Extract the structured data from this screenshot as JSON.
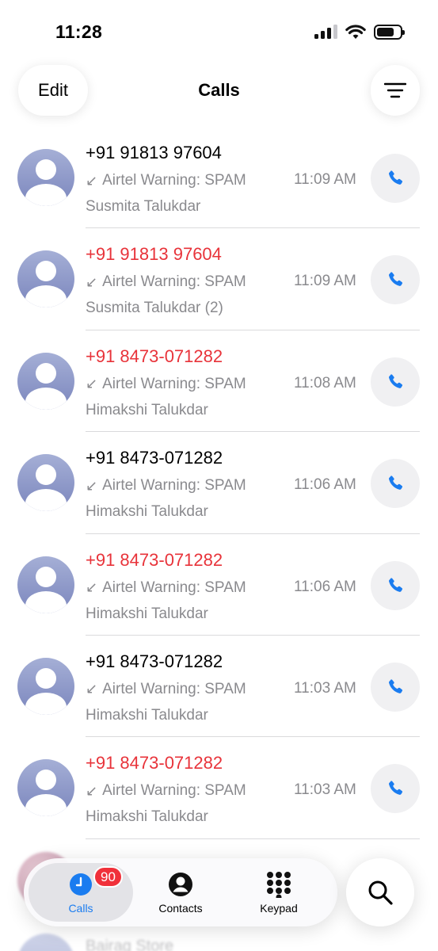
{
  "status_bar": {
    "time": "11:28"
  },
  "header": {
    "edit_label": "Edit",
    "title": "Calls"
  },
  "calls": [
    {
      "caller": "+91 91813 97604",
      "missed": false,
      "label": "Airtel Warning: SPAM",
      "name": "Susmita Talukdar",
      "time": "11:09 AM"
    },
    {
      "caller": "+91 91813 97604",
      "missed": true,
      "label": "Airtel Warning: SPAM",
      "name": "Susmita Talukdar (2)",
      "time": "11:09 AM"
    },
    {
      "caller": "+91 8473-071282",
      "missed": true,
      "label": "Airtel Warning: SPAM",
      "name": "Himakshi Talukdar",
      "time": "11:08 AM"
    },
    {
      "caller": "+91 8473-071282",
      "missed": false,
      "label": "Airtel Warning: SPAM",
      "name": "Himakshi Talukdar",
      "time": "11:06 AM"
    },
    {
      "caller": "+91 8473-071282",
      "missed": true,
      "label": "Airtel Warning: SPAM",
      "name": "Himakshi Talukdar",
      "time": "11:06 AM"
    },
    {
      "caller": "+91 8473-071282",
      "missed": false,
      "label": "Airtel Warning: SPAM",
      "name": "Himakshi Talukdar",
      "time": "11:03 AM"
    },
    {
      "caller": "+91 8473-071282",
      "missed": true,
      "label": "Airtel Warning: SPAM",
      "name": "Himakshi Talukdar",
      "time": "11:03 AM"
    }
  ],
  "partial_row": {
    "name": "Bairag Store"
  },
  "tab_bar": {
    "calls_label": "Calls",
    "calls_badge": "90",
    "contacts_label": "Contacts",
    "keypad_label": "Keypad"
  },
  "colors": {
    "accent": "#1a7cf0",
    "missed": "#e8333a",
    "secondary_text": "#8a8a8e",
    "badge": "#f0303a"
  },
  "icons": {
    "arrow": "incoming-arrow-icon",
    "call": "phone-icon",
    "filter": "filter-icon",
    "search": "search-icon",
    "calls_tab": "clock-icon",
    "contacts_tab": "person-circle-icon",
    "keypad_tab": "keypad-icon"
  }
}
